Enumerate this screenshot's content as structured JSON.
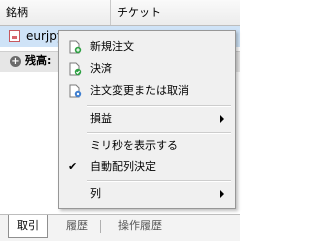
{
  "grid": {
    "columns": [
      "銘柄",
      "チケット"
    ],
    "selected_row": {
      "symbol": "eurjpy",
      "extra": ""
    },
    "balance_label": "残高:",
    "balance_toggle": "+"
  },
  "tabs": [
    "取引",
    "履歴",
    "操作履歴"
  ],
  "context_menu": {
    "items": [
      {
        "label": "新規注文",
        "icon": "new-document-icon"
      },
      {
        "label": "決済",
        "icon": "green-check-icon"
      },
      {
        "label": "注文変更または取消",
        "icon": "gear-document-icon"
      },
      {
        "label": "損益",
        "has_submenu": true
      },
      {
        "label": "ミリ秒を表示する"
      },
      {
        "label": "自動配列決定",
        "checked": true,
        "check_mark": "✔"
      },
      {
        "label": "列",
        "has_submenu": true
      }
    ]
  },
  "colors": {
    "selection": "#cfe3f7",
    "menu_bg": "#f0f0f0"
  }
}
